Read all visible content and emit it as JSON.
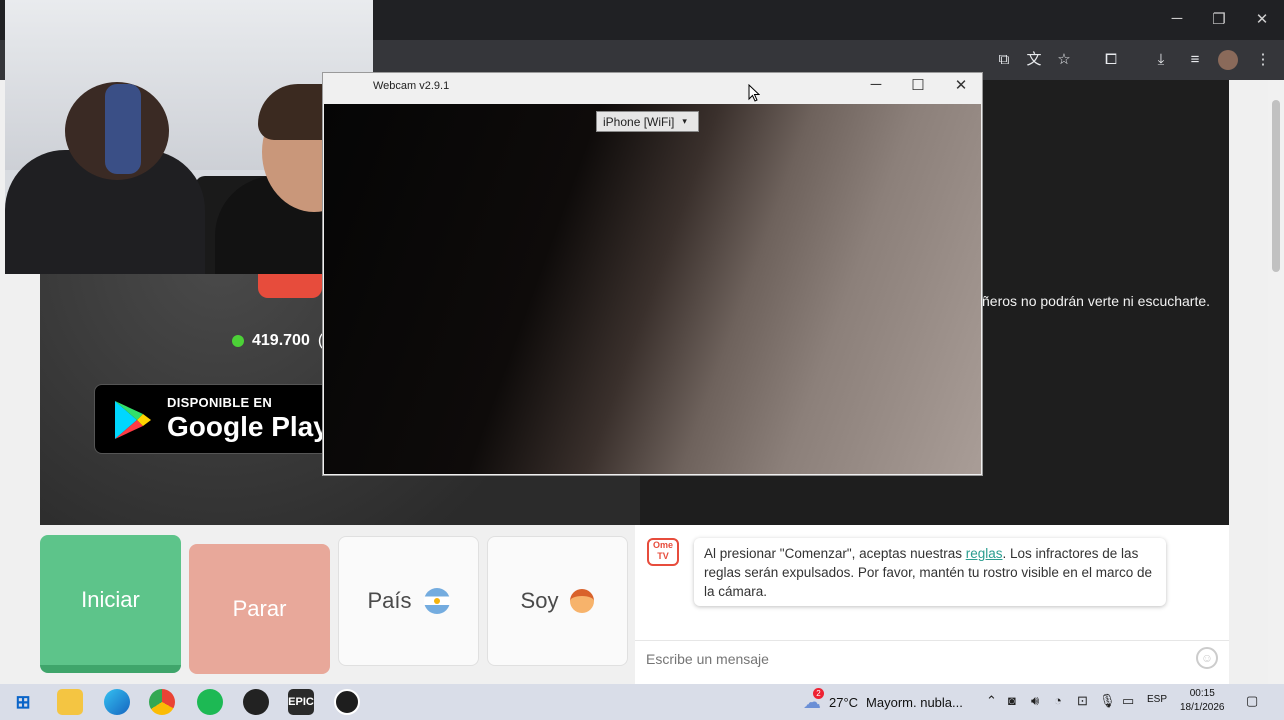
{
  "browser": {
    "window_controls": [
      "─",
      "❐",
      "✕"
    ],
    "toolbar_icons": [
      "cast-icon",
      "translate-icon",
      "star-icon",
      "extensions-icon",
      "download-icon",
      "media-icon",
      "avatar",
      "menu-icon"
    ]
  },
  "page": {
    "warning_fragment": "ñeros no podrán verte ni escucharte.",
    "online_count": "419.700",
    "online_suffix": "(",
    "google_play": {
      "small": "DISPONIBLE EN",
      "big": "Google Play"
    },
    "buttons": {
      "start": "Iniciar",
      "stop": "Parar",
      "country": "País",
      "gender": "Soy"
    },
    "chat": {
      "logo_text": "Ome TV",
      "message_before": "Al presionar \"Comenzar\", aceptas nuestras ",
      "message_link": "reglas",
      "message_after": ". Los infractores de las reglas serán expulsados. Por favor, mantén tu rostro visible en el marco de la cámara.",
      "input_placeholder": "Escribe un mensaje"
    }
  },
  "webcam_app": {
    "title": "Webcam v2.9.1",
    "controls": [
      "─",
      "☐",
      "✕"
    ],
    "source_selected": "iPhone [WiFi]"
  },
  "taskbar": {
    "apps": [
      "windows-icon",
      "search-icon",
      "file-explorer-icon",
      "edge-icon",
      "chrome-icon",
      "spotify-icon",
      "app-icon",
      "epic-games-icon",
      "obs-icon"
    ],
    "epic_label": "EPIC",
    "weather_badge": "2",
    "temperature": "27°C",
    "weather_desc": "Mayorm. nubla...",
    "language": "ESP",
    "time": "00:15",
    "date": "18/1/2026"
  },
  "colors": {
    "start_button": "#5dc48a",
    "stop_button": "#e8a89a",
    "link": "#2a9d8f",
    "online_dot": "#4cd137",
    "brand_red": "#e74c3c"
  }
}
